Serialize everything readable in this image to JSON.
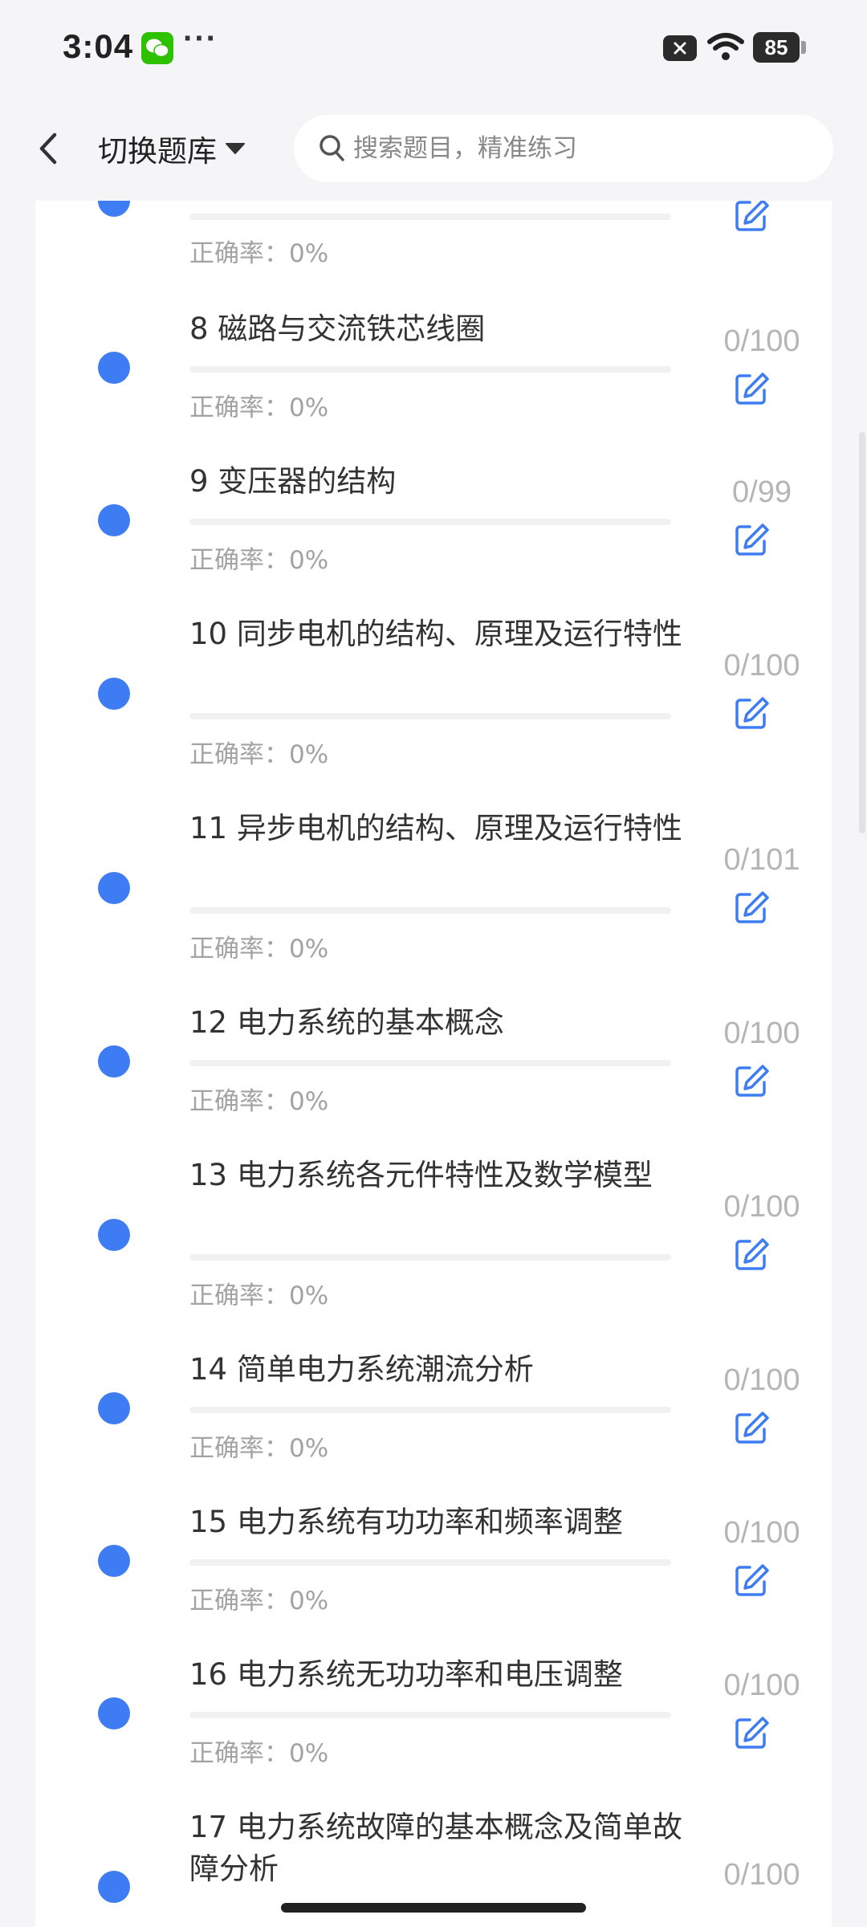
{
  "status_bar": {
    "time": "3:04",
    "more": "···",
    "battery": "85"
  },
  "header": {
    "switch_label": "切换题库",
    "search_placeholder": "搜索题目，精准练习"
  },
  "accuracy_label": "正确率：",
  "accent_color": "#3e7cf4",
  "items": [
    {
      "title": "",
      "progress": 0,
      "accuracy": "0%",
      "count": ""
    },
    {
      "title": "8 磁路与交流铁芯线圈",
      "progress": 0,
      "accuracy": "0%",
      "count": "0/100"
    },
    {
      "title": "9 变压器的结构",
      "progress": 0,
      "accuracy": "0%",
      "count": "0/99"
    },
    {
      "title": "10 同步电机的结构、原理及运行特性",
      "progress": 0,
      "accuracy": "0%",
      "count": "0/100"
    },
    {
      "title": "11 异步电机的结构、原理及运行特性",
      "progress": 0,
      "accuracy": "0%",
      "count": "0/101"
    },
    {
      "title": "12 电力系统的基本概念",
      "progress": 0,
      "accuracy": "0%",
      "count": "0/100"
    },
    {
      "title": "13 电力系统各元件特性及数学模型",
      "progress": 0,
      "accuracy": "0%",
      "count": "0/100"
    },
    {
      "title": "14 简单电力系统潮流分析",
      "progress": 0,
      "accuracy": "0%",
      "count": "0/100"
    },
    {
      "title": "15 电力系统有功功率和频率调整",
      "progress": 0,
      "accuracy": "0%",
      "count": "0/100"
    },
    {
      "title": "16 电力系统无功功率和电压调整",
      "progress": 0,
      "accuracy": "0%",
      "count": "0/100"
    },
    {
      "title": "17 电力系统故障的基本概念及简单故障分析",
      "progress": 0,
      "accuracy": "",
      "count": "0/100"
    }
  ]
}
